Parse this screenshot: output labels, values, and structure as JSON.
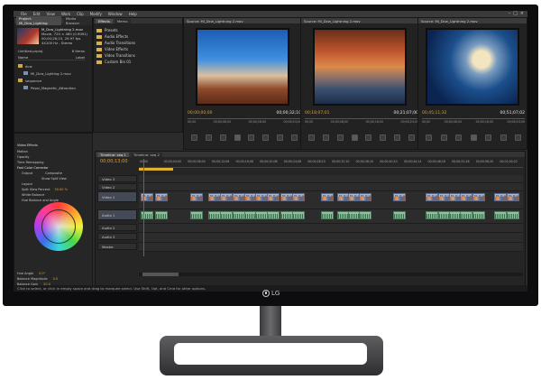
{
  "brand": "LG",
  "menu": [
    "File",
    "Edit",
    "View",
    "Work",
    "Clip",
    "Modify",
    "Window",
    "Help"
  ],
  "window_controls": [
    "–",
    "□",
    "×"
  ],
  "project": {
    "tabs": [
      "Project: Mi_Dcw_Lighting",
      "Media Browser",
      "Effects",
      "Memo"
    ],
    "clip_name": "M_Dcw_Lightning 2.mov",
    "clip_info": [
      "Movie, 720 × 480 (0.9091)",
      "00;00;26;15, 29.97 fps",
      "44100 Hz - Stereo"
    ],
    "project_name": "Untitled.prproj",
    "item_count": "6 Items",
    "col_name": "Name",
    "col_label": "Label",
    "items": [
      "dcw",
      "Mi_Dcw_Lighting 2.mov",
      "sequence",
      "Pepsi_Magnetic_Attraction"
    ]
  },
  "effects_panel": {
    "items": [
      "Presets",
      "Audio Effects",
      "Audio Transitions",
      "Video Effects",
      "Video Transitions",
      "Custom Bin 01"
    ]
  },
  "effect_controls": {
    "title": "Video Effects",
    "lines": [
      "Motion",
      "Opacity",
      "Time Remapping",
      "Fast Color Corrector",
      "Output",
      "Show Split View",
      "Layout",
      "Split View Percent",
      "White Balance",
      "Hue Balance and Angle"
    ],
    "lower_lines": [
      "Hue Angle",
      "Balance Magnitude",
      "Balance Gain"
    ],
    "values": {
      "output": "Composite",
      "split_pct": "50.00 %",
      "hue_angle": "0.0°",
      "magnitude": "0.0",
      "gain": "20.0"
    }
  },
  "monitors": [
    {
      "title": "Source: Mi_Dcw_Lightning 2.mov",
      "tc_left": "00;00;00;00",
      "tc_right": "00;00;32;10",
      "ruler": [
        "00;00",
        "00;00;08;00",
        "00;00;16;00",
        "00;00;24;00"
      ]
    },
    {
      "title": "Source: Mi_Dcw_Lightning 2.mov",
      "tc_left": "00;18;07;01",
      "tc_right": "00;21;07;00",
      "ruler": [
        "00;00",
        "00;00;08;00",
        "00;00;16;00",
        "00;00;24;00"
      ]
    },
    {
      "title": "Source: Mi_Dcw_Lightning 2.mov",
      "tc_left": "00;45;11;32",
      "tc_right": "00;51;07;02",
      "ruler": [
        "00;00",
        "00;00;08;00",
        "00;00;16;00",
        "00;00;24;00"
      ]
    }
  ],
  "timeline": {
    "tabs": [
      "Timeline: seq 1",
      "Timeline: seq 2"
    ],
    "timecode": "00;00;13;00",
    "ruler": [
      "00;00",
      "00;00;04;00",
      "00;00;08;04",
      "00;00;12;06",
      "00;00;16;08",
      "00;00;20;08",
      "00;00;24;08",
      "00;00;28;10",
      "00;00;32;10",
      "00;00;36;10",
      "00;00;40;10",
      "00;00;44;14",
      "00;00;48;16",
      "00;00;52;18",
      "00;00;56;20",
      "00;01;00;22"
    ],
    "tracks_video": [
      "Video 3",
      "Video 2",
      "Video 1"
    ],
    "tracks_audio": [
      "Audio 1",
      "Audio 2",
      "Audio 3",
      "Master"
    ],
    "clip_label": "Mi_Dcw_1"
  },
  "status": "Click to select, or click in empty space and drag to marquee select. Use Shift, Opt, and Cmd for other options."
}
